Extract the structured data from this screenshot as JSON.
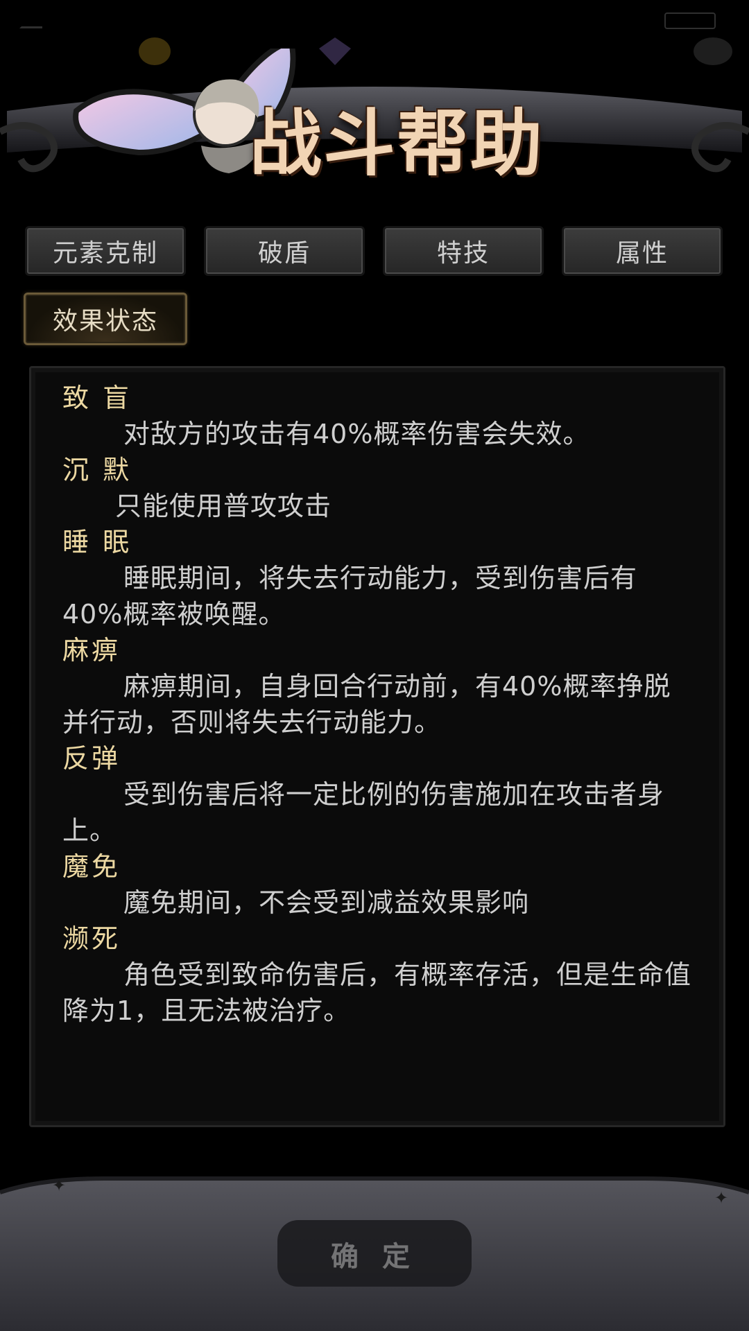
{
  "title": "战斗帮助",
  "tabs": [
    {
      "label": "元素克制",
      "active": false
    },
    {
      "label": "破盾",
      "active": false
    },
    {
      "label": "特技",
      "active": false
    },
    {
      "label": "属性",
      "active": false
    },
    {
      "label": "效果状态",
      "active": true
    }
  ],
  "entries": [
    {
      "name": "致 盲",
      "desc": "对敌方的攻击有40%概率伤害会失效。"
    },
    {
      "name": "沉 默",
      "desc": "只能使用普攻攻击"
    },
    {
      "name": "睡 眠",
      "desc": "睡眠期间，将失去行动能力，受到伤害后有40%概率被唤醒。"
    },
    {
      "name": "麻痹",
      "desc": "麻痹期间，自身回合行动前，有40%概率挣脱并行动，否则将失去行动能力。"
    },
    {
      "name": "反弹",
      "desc": "受到伤害后将一定比例的伤害施加在攻击者身上。"
    },
    {
      "name": "魔免",
      "desc": "魔免期间，不会受到减益效果影响"
    },
    {
      "name": "濒死",
      "desc": "角色受到致命伤害后，有概率存活，但是生命值降为1，且无法被治疗。"
    }
  ],
  "confirm_label": "确 定",
  "colors": {
    "entry_name": "#ecd8a2",
    "desc_text": "#cfcfcf",
    "title": "#f1d4b4"
  }
}
